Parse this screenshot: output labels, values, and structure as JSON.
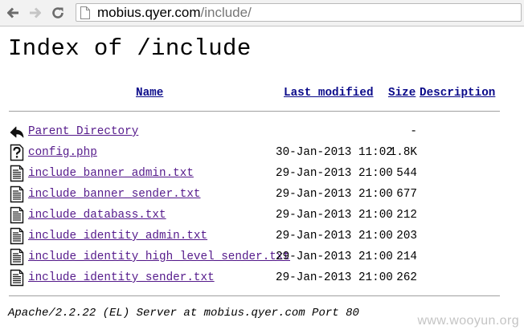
{
  "browser": {
    "url_host": "mobius.qyer.com",
    "url_path": "/include/"
  },
  "page": {
    "title": "Index of /include",
    "columns": {
      "name": "Name",
      "last_modified": "Last modified",
      "size": "Size",
      "description": "Description"
    },
    "rows": [
      {
        "icon": "back-icon",
        "name": "Parent Directory",
        "date": "",
        "size": "-"
      },
      {
        "icon": "unknown-file-icon",
        "name": "config.php",
        "date": "30-Jan-2013 11:02",
        "size": "1.8K"
      },
      {
        "icon": "text-file-icon",
        "name": "include_banner_admin.txt",
        "date": "29-Jan-2013 21:00",
        "size": "544"
      },
      {
        "icon": "text-file-icon",
        "name": "include_banner_sender.txt",
        "date": "29-Jan-2013 21:00",
        "size": "677"
      },
      {
        "icon": "text-file-icon",
        "name": "include_databass.txt",
        "date": "29-Jan-2013 21:00",
        "size": "212"
      },
      {
        "icon": "text-file-icon",
        "name": "include_identity_admin.txt",
        "date": "29-Jan-2013 21:00",
        "size": "203"
      },
      {
        "icon": "text-file-icon",
        "name": "include_identity_high_level_sender.txt",
        "date": "29-Jan-2013 21:00",
        "size": "214"
      },
      {
        "icon": "text-file-icon",
        "name": "include_identity_sender.txt",
        "date": "29-Jan-2013 21:00",
        "size": "262"
      }
    ],
    "footer": "Apache/2.2.22 (EL) Server at mobius.qyer.com Port 80"
  },
  "watermark": "www.wooyun.org",
  "colors": {
    "visited_link": "#551a8b",
    "header_link": "#0b0b8a",
    "toolbar_bg": "#f2f2f2"
  }
}
